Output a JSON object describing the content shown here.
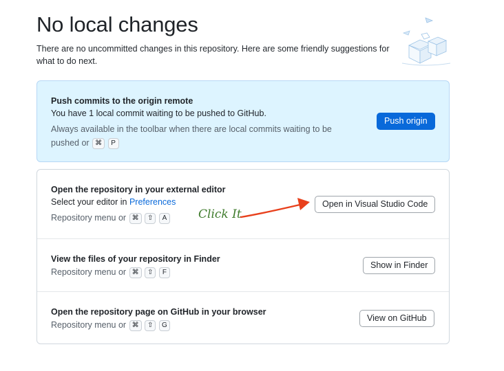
{
  "header": {
    "title": "No local changes",
    "subtitle": "There are no uncommitted changes in this repository. Here are some friendly suggestions for what to do next."
  },
  "push_card": {
    "heading": "Push commits to the origin remote",
    "text": "You have 1 local commit waiting to be pushed to GitHub.",
    "meta": "Always available in the toolbar when there are local commits waiting to be pushed or",
    "keys": [
      "⌘",
      "P"
    ],
    "button_label": "Push origin"
  },
  "editor_row": {
    "heading": "Open the repository in your external editor",
    "text": "Select your editor in",
    "link": "Preferences",
    "meta": "Repository menu or",
    "keys": [
      "⌘",
      "⇧",
      "A"
    ],
    "button_label": "Open in Visual Studio Code"
  },
  "finder_row": {
    "heading": "View the files of your repository in Finder",
    "meta": "Repository menu or",
    "keys": [
      "⌘",
      "⇧",
      "F"
    ],
    "button_label": "Show in Finder"
  },
  "github_row": {
    "heading": "Open the repository page on GitHub in your browser",
    "meta": "Repository menu or",
    "keys": [
      "⌘",
      "⇧",
      "G"
    ],
    "button_label": "View on GitHub"
  },
  "annotation": {
    "text": "Click It",
    "color": "#3d7a2a",
    "arrow_color": "#e8401c"
  },
  "colors": {
    "accent": "#0969da",
    "push_card_bg": "#ddf4ff"
  }
}
